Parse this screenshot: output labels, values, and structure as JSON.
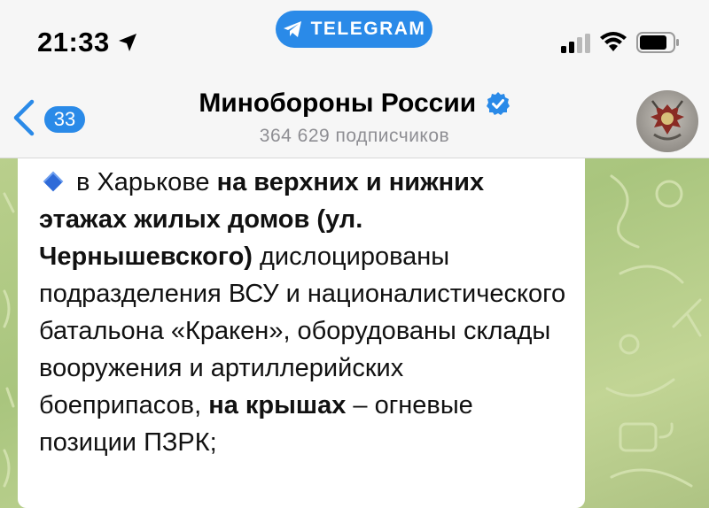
{
  "status_bar": {
    "time": "21:33",
    "location_icon": "location-arrow-icon",
    "app_pill_label": "TELEGRAM",
    "app_pill_icon": "telegram-plane-icon",
    "signal_icon": "cellular-signal-icon",
    "wifi_icon": "wifi-icon",
    "battery_icon": "battery-icon"
  },
  "header": {
    "back_icon": "chevron-left-icon",
    "unread_count": "33",
    "channel_title": "Минобороны России",
    "verified_icon": "verified-check-icon",
    "subscribers": "364 629 подписчиков",
    "avatar_icon": "channel-emblem-avatar"
  },
  "message": {
    "bullet_icon": "blue-diamond-icon",
    "segments": [
      {
        "text": "в Харькове ",
        "bold": false
      },
      {
        "text": "на верхних и нижних этажах жилых домов (ул. Чернышевского)",
        "bold": true
      },
      {
        "text": " дислоцированы подразделения ВСУ и националистического батальона «Кракен», оборудованы склады вооружения и артиллерийских боеприпасов, ",
        "bold": false
      },
      {
        "text": "на крышах",
        "bold": true
      },
      {
        "text": " – огневые позиции ПЗРК;",
        "bold": false
      }
    ]
  },
  "colors": {
    "accent": "#2a8ae8",
    "chat_background": "#b5cc88",
    "bubble": "#ffffff",
    "subtitle": "#8e8e93"
  }
}
